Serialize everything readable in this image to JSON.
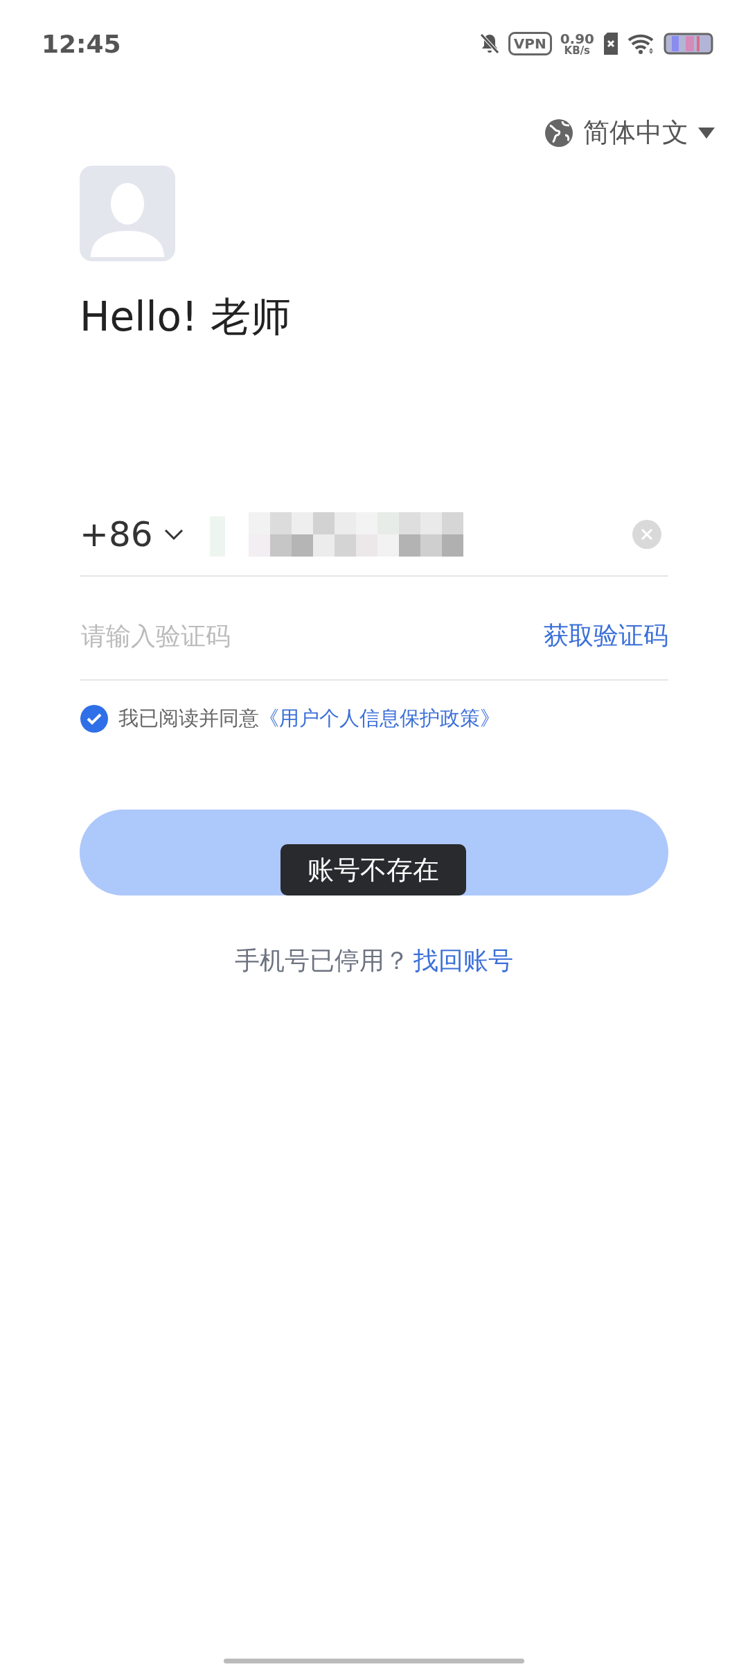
{
  "status_bar": {
    "time": "12:45",
    "vpn_label": "VPN",
    "speed_value": "0.90",
    "speed_unit": "KB/s"
  },
  "language": {
    "label": "简体中文"
  },
  "greeting": "Hello! 老师",
  "phone": {
    "country_code": "+86"
  },
  "code": {
    "placeholder": "请输入验证码",
    "action": "获取验证码"
  },
  "agreement": {
    "checked": true,
    "text": "我已阅读并同意",
    "link": "《用户个人信息保护政策》"
  },
  "login_button": {
    "disabled": true
  },
  "toast": "账号不存在",
  "footer": {
    "question": "手机号已停用？",
    "link": "找回账号"
  }
}
